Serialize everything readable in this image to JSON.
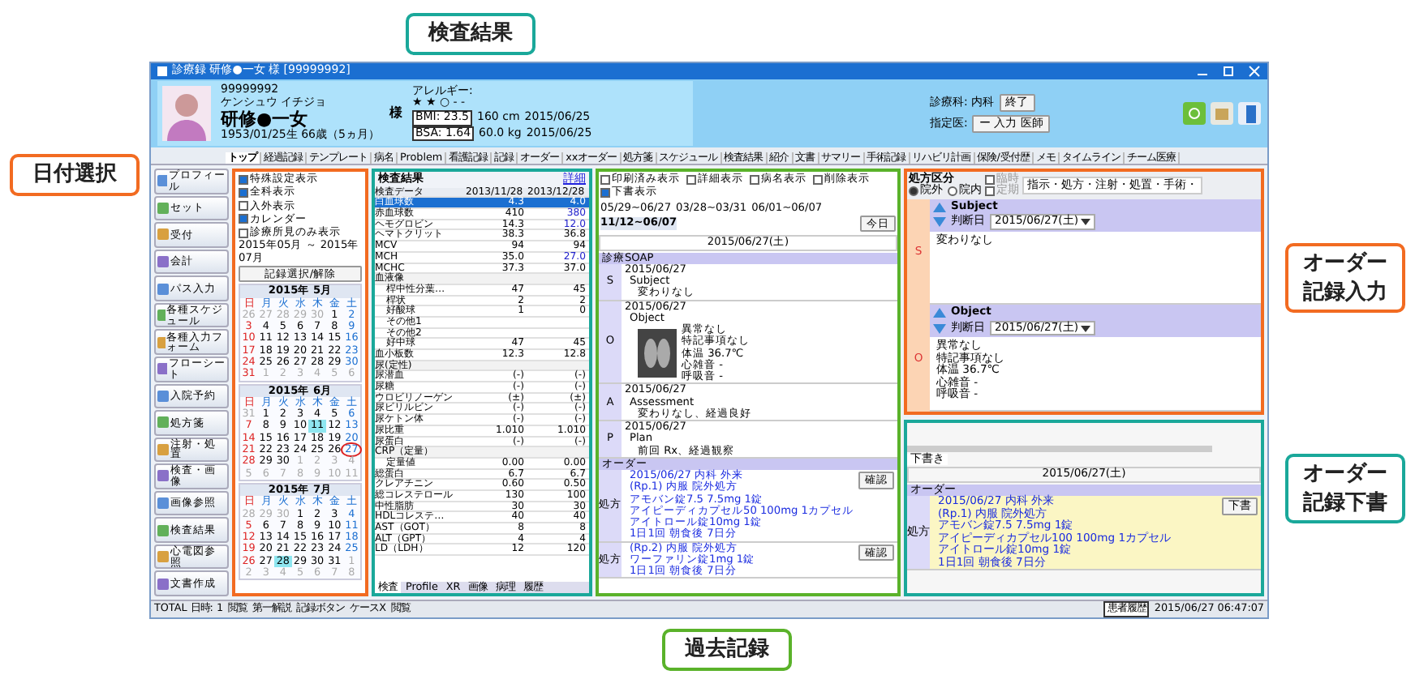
{
  "callouts": [
    {
      "text": "日付選択",
      "color": "#f26b21"
    },
    {
      "text": "検査結果",
      "color": "#1aa89a"
    },
    {
      "text": "オーダー記録入力",
      "color": "#f26b21"
    },
    {
      "text": "オーダー記録下書",
      "color": "#1aa89a"
    },
    {
      "text": "過去記録",
      "color": "#5ab22a"
    }
  ],
  "window": {
    "title": "診療録 研修●一女 様 [99999992]"
  },
  "patient": {
    "id": "99999992",
    "kana": "ケンシュウ イチジョ",
    "name": "研修●一女",
    "honorific": "様",
    "dob": "1953/01/25生 66歳（5ヵ月）",
    "allergy_label": "アレルギー:",
    "allergy_marks": "★ ★ ○ - -",
    "bmi": "BMI: 23.5",
    "bsa": "BSA: 1.64",
    "height": "160 cm",
    "weight": "60.0 kg",
    "height_date": "2015/06/25",
    "weight_date": "2015/06/25",
    "dept": "診療科: 内科",
    "dept_button": "終了",
    "doctor_label": "指定医:",
    "doctor": "ー 入力 医師"
  },
  "tabs": [
    {
      "label": "トップ",
      "selected": true
    },
    {
      "label": "経過記録",
      "selected": false
    },
    {
      "label": "テンプレート",
      "selected": false
    },
    {
      "label": "病名",
      "selected": false
    },
    {
      "label": "Problem",
      "selected": false
    },
    {
      "label": "看護記録",
      "selected": false
    },
    {
      "label": "記録",
      "selected": false
    },
    {
      "label": "オーダー",
      "selected": false
    },
    {
      "label": "xxオーダー",
      "selected": false
    },
    {
      "label": "処方箋",
      "selected": false
    },
    {
      "label": "スケジュール",
      "selected": false
    },
    {
      "label": "検査結果",
      "selected": false
    },
    {
      "label": "紹介",
      "selected": false
    },
    {
      "label": "文書",
      "selected": false
    },
    {
      "label": "サマリー",
      "selected": false
    },
    {
      "label": "手術記録",
      "selected": false
    },
    {
      "label": "リハビリ計画",
      "selected": false
    },
    {
      "label": "保険/受付歴",
      "selected": false
    },
    {
      "label": "メモ",
      "selected": false
    },
    {
      "label": "タイムライン",
      "selected": false
    },
    {
      "label": "チーム医療",
      "selected": false
    }
  ],
  "sidebar": [
    {
      "label": "プロフィール"
    },
    {
      "label": "セット"
    },
    {
      "label": "受付"
    },
    {
      "label": "会計"
    },
    {
      "label": "パス入力"
    },
    {
      "label": "各種スケジュール"
    },
    {
      "label": "各種入力フォーム"
    },
    {
      "label": "フローシート"
    },
    {
      "label": "入院予約"
    },
    {
      "label": "処方箋"
    },
    {
      "label": "注射・処置"
    },
    {
      "label": "検査・画像"
    },
    {
      "label": "画像参照"
    },
    {
      "label": "検査結果"
    },
    {
      "label": "心電図参照"
    },
    {
      "label": "文書作成"
    }
  ],
  "date_panel": {
    "options": [
      {
        "label": "特殊設定表示",
        "checked": true
      },
      {
        "label": "全科表示",
        "checked": true
      },
      {
        "label": "入外表示",
        "checked": false
      },
      {
        "label": "カレンダー",
        "checked": true
      },
      {
        "label": "診療所見のみ表示",
        "checked": false
      }
    ],
    "range": "2015年05月 ～ 2015年07月",
    "select_button": "記録選択/解除",
    "months": [
      {
        "title": "2015年 5月",
        "weekdays": [
          "日",
          "月",
          "火",
          "水",
          "木",
          "金",
          "土"
        ],
        "days": [
          {
            "day": "26",
            "kind": "out"
          },
          {
            "day": "27",
            "kind": "out"
          },
          {
            "day": "28",
            "kind": "out"
          },
          {
            "day": "29",
            "kind": "out"
          },
          {
            "day": "30",
            "kind": "out"
          },
          {
            "day": "1",
            "kind": "in"
          },
          {
            "day": "2",
            "kind": "in"
          },
          {
            "day": "3",
            "kind": "in"
          },
          {
            "day": "4",
            "kind": "in"
          },
          {
            "day": "5",
            "kind": "in"
          },
          {
            "day": "6",
            "kind": "in"
          },
          {
            "day": "7",
            "kind": "in"
          },
          {
            "day": "8",
            "kind": "in"
          },
          {
            "day": "9",
            "kind": "in"
          },
          {
            "day": "10",
            "kind": "in"
          },
          {
            "day": "11",
            "kind": "in"
          },
          {
            "day": "12",
            "kind": "in"
          },
          {
            "day": "13",
            "kind": "in"
          },
          {
            "day": "14",
            "kind": "in"
          },
          {
            "day": "15",
            "kind": "in"
          },
          {
            "day": "16",
            "kind": "in"
          },
          {
            "day": "17",
            "kind": "in"
          },
          {
            "day": "18",
            "kind": "in"
          },
          {
            "day": "19",
            "kind": "in"
          },
          {
            "day": "20",
            "kind": "in"
          },
          {
            "day": "21",
            "kind": "in"
          },
          {
            "day": "22",
            "kind": "in"
          },
          {
            "day": "23",
            "kind": "in"
          },
          {
            "day": "24",
            "kind": "in"
          },
          {
            "day": "25",
            "kind": "in"
          },
          {
            "day": "26",
            "kind": "in"
          },
          {
            "day": "27",
            "kind": "in"
          },
          {
            "day": "28",
            "kind": "in"
          },
          {
            "day": "29",
            "kind": "in"
          },
          {
            "day": "30",
            "kind": "in"
          },
          {
            "day": "31",
            "kind": "in"
          },
          {
            "day": "1",
            "kind": "out"
          },
          {
            "day": "2",
            "kind": "out"
          },
          {
            "day": "3",
            "kind": "out"
          },
          {
            "day": "4",
            "kind": "out"
          },
          {
            "day": "5",
            "kind": "out"
          },
          {
            "day": "6",
            "kind": "out"
          }
        ]
      },
      {
        "title": "2015年 6月",
        "weekdays": [
          "日",
          "月",
          "火",
          "水",
          "木",
          "金",
          "土"
        ],
        "days": [
          {
            "day": "31",
            "kind": "out"
          },
          {
            "day": "1",
            "kind": "in"
          },
          {
            "day": "2",
            "kind": "in"
          },
          {
            "day": "3",
            "kind": "in"
          },
          {
            "day": "4",
            "kind": "in"
          },
          {
            "day": "5",
            "kind": "in"
          },
          {
            "day": "6",
            "kind": "in"
          },
          {
            "day": "7",
            "kind": "in"
          },
          {
            "day": "8",
            "kind": "in"
          },
          {
            "day": "9",
            "kind": "in"
          },
          {
            "day": "10",
            "kind": "in"
          },
          {
            "day": "11",
            "kind": "mark"
          },
          {
            "day": "12",
            "kind": "in"
          },
          {
            "day": "13",
            "kind": "in"
          },
          {
            "day": "14",
            "kind": "in"
          },
          {
            "day": "15",
            "kind": "in"
          },
          {
            "day": "16",
            "kind": "in"
          },
          {
            "day": "17",
            "kind": "in"
          },
          {
            "day": "18",
            "kind": "in"
          },
          {
            "day": "19",
            "kind": "in"
          },
          {
            "day": "20",
            "kind": "in"
          },
          {
            "day": "21",
            "kind": "in"
          },
          {
            "day": "22",
            "kind": "in"
          },
          {
            "day": "23",
            "kind": "in"
          },
          {
            "day": "24",
            "kind": "in"
          },
          {
            "day": "25",
            "kind": "in"
          },
          {
            "day": "26",
            "kind": "in"
          },
          {
            "day": "27",
            "kind": "today"
          },
          {
            "day": "28",
            "kind": "in"
          },
          {
            "day": "29",
            "kind": "in"
          },
          {
            "day": "30",
            "kind": "in"
          },
          {
            "day": "1",
            "kind": "out"
          },
          {
            "day": "2",
            "kind": "out"
          },
          {
            "day": "3",
            "kind": "out"
          },
          {
            "day": "4",
            "kind": "out"
          },
          {
            "day": "5",
            "kind": "out"
          },
          {
            "day": "6",
            "kind": "out"
          },
          {
            "day": "7",
            "kind": "out"
          },
          {
            "day": "8",
            "kind": "out"
          },
          {
            "day": "9",
            "kind": "out"
          },
          {
            "day": "10",
            "kind": "out"
          },
          {
            "day": "11",
            "kind": "out"
          }
        ]
      },
      {
        "title": "2015年 7月",
        "weekdays": [
          "日",
          "月",
          "火",
          "水",
          "木",
          "金",
          "土"
        ],
        "days": [
          {
            "day": "28",
            "kind": "out"
          },
          {
            "day": "29",
            "kind": "out"
          },
          {
            "day": "30",
            "kind": "out"
          },
          {
            "day": "1",
            "kind": "in"
          },
          {
            "day": "2",
            "kind": "in"
          },
          {
            "day": "3",
            "kind": "in"
          },
          {
            "day": "4",
            "kind": "in"
          },
          {
            "day": "5",
            "kind": "in"
          },
          {
            "day": "6",
            "kind": "in"
          },
          {
            "day": "7",
            "kind": "in"
          },
          {
            "day": "8",
            "kind": "in"
          },
          {
            "day": "9",
            "kind": "in"
          },
          {
            "day": "10",
            "kind": "in"
          },
          {
            "day": "11",
            "kind": "in"
          },
          {
            "day": "12",
            "kind": "in"
          },
          {
            "day": "13",
            "kind": "in"
          },
          {
            "day": "14",
            "kind": "in"
          },
          {
            "day": "15",
            "kind": "in"
          },
          {
            "day": "16",
            "kind": "in"
          },
          {
            "day": "17",
            "kind": "in"
          },
          {
            "day": "18",
            "kind": "in"
          },
          {
            "day": "19",
            "kind": "in"
          },
          {
            "day": "20",
            "kind": "in"
          },
          {
            "day": "21",
            "kind": "in"
          },
          {
            "day": "22",
            "kind": "in"
          },
          {
            "day": "23",
            "kind": "in"
          },
          {
            "day": "24",
            "kind": "in"
          },
          {
            "day": "25",
            "kind": "in"
          },
          {
            "day": "26",
            "kind": "in"
          },
          {
            "day": "27",
            "kind": "in"
          },
          {
            "day": "28",
            "kind": "mark"
          },
          {
            "day": "29",
            "kind": "in"
          },
          {
            "day": "30",
            "kind": "in"
          },
          {
            "day": "31",
            "kind": "in"
          },
          {
            "day": "1",
            "kind": "out"
          },
          {
            "day": "2",
            "kind": "out"
          },
          {
            "day": "3",
            "kind": "out"
          },
          {
            "day": "4",
            "kind": "out"
          },
          {
            "day": "5",
            "kind": "out"
          },
          {
            "day": "6",
            "kind": "out"
          },
          {
            "day": "7",
            "kind": "out"
          },
          {
            "day": "8",
            "kind": "out"
          }
        ]
      }
    ]
  },
  "lab": {
    "title": "検査結果",
    "detail_link": "詳細",
    "columns": [
      "検査データ",
      "2013/11/28",
      "2013/12/28"
    ],
    "rows": [
      {
        "name": "白血球数",
        "kind": "data",
        "selected": true,
        "values": [
          {
            "text": "4.3",
            "low": false
          },
          {
            "text": "4.0",
            "low": false
          }
        ]
      },
      {
        "name": "赤血球数",
        "kind": "data",
        "selected": false,
        "values": [
          {
            "text": "410",
            "low": false
          },
          {
            "text": "380",
            "low": true
          }
        ]
      },
      {
        "name": "ヘモグロビン",
        "kind": "data",
        "selected": false,
        "values": [
          {
            "text": "14.3",
            "low": false
          },
          {
            "text": "12.0",
            "low": true
          }
        ]
      },
      {
        "name": "ヘマトクリット",
        "kind": "data",
        "selected": false,
        "values": [
          {
            "text": "38.3",
            "low": false
          },
          {
            "text": "36.8",
            "low": false
          }
        ]
      },
      {
        "name": "MCV",
        "kind": "data",
        "selected": false,
        "values": [
          {
            "text": "94",
            "low": false
          },
          {
            "text": "94",
            "low": false
          }
        ]
      },
      {
        "name": "MCH",
        "kind": "data",
        "selected": false,
        "values": [
          {
            "text": "35.0",
            "low": false
          },
          {
            "text": "27.0",
            "low": true
          }
        ]
      },
      {
        "name": "MCHC",
        "kind": "data",
        "selected": false,
        "values": [
          {
            "text": "37.3",
            "low": false
          },
          {
            "text": "37.0",
            "low": false
          }
        ]
      },
      {
        "name": "血液像",
        "kind": "section",
        "selected": false,
        "values": []
      },
      {
        "name": "桿中性分葉…",
        "kind": "sub",
        "selected": false,
        "values": [
          {
            "text": "47",
            "low": false
          },
          {
            "text": "45",
            "low": false
          }
        ]
      },
      {
        "name": "桿状",
        "kind": "sub",
        "selected": false,
        "values": [
          {
            "text": "2",
            "low": false
          },
          {
            "text": "2",
            "low": false
          }
        ]
      },
      {
        "name": "好酸球",
        "kind": "sub",
        "selected": false,
        "values": [
          {
            "text": "1",
            "low": false
          },
          {
            "text": "0",
            "low": false
          }
        ]
      },
      {
        "name": "その他1",
        "kind": "sub",
        "selected": false,
        "values": []
      },
      {
        "name": "その他2",
        "kind": "sub",
        "selected": false,
        "values": []
      },
      {
        "name": "好中球",
        "kind": "sub",
        "selected": false,
        "values": [
          {
            "text": "47",
            "low": false
          },
          {
            "text": "45",
            "low": false
          }
        ]
      },
      {
        "name": "血小板数",
        "kind": "data",
        "selected": false,
        "values": [
          {
            "text": "12.3",
            "low": false
          },
          {
            "text": "12.8",
            "low": false
          }
        ]
      },
      {
        "name": "尿(定性)",
        "kind": "section",
        "selected": false,
        "values": []
      },
      {
        "name": "尿潜血",
        "kind": "data",
        "selected": false,
        "values": [
          {
            "text": "(-)",
            "low": false
          },
          {
            "text": "(-)",
            "low": false
          }
        ]
      },
      {
        "name": "尿糖",
        "kind": "data",
        "selected": false,
        "values": [
          {
            "text": "(-)",
            "low": false
          },
          {
            "text": "(-)",
            "low": false
          }
        ]
      },
      {
        "name": "ウロビリノーゲン",
        "kind": "data",
        "selected": false,
        "values": [
          {
            "text": "(±)",
            "low": false
          },
          {
            "text": "(±)",
            "low": false
          }
        ]
      },
      {
        "name": "尿ビリルビン",
        "kind": "data",
        "selected": false,
        "values": [
          {
            "text": "(-)",
            "low": false
          },
          {
            "text": "(-)",
            "low": false
          }
        ]
      },
      {
        "name": "尿ケトン体",
        "kind": "data",
        "selected": false,
        "values": [
          {
            "text": "(-)",
            "low": false
          },
          {
            "text": "(-)",
            "low": false
          }
        ]
      },
      {
        "name": "尿比重",
        "kind": "data",
        "selected": false,
        "values": [
          {
            "text": "1.010",
            "low": false
          },
          {
            "text": "1.010",
            "low": false
          }
        ]
      },
      {
        "name": "尿蛋白",
        "kind": "data",
        "selected": false,
        "values": [
          {
            "text": "(-)",
            "low": false
          },
          {
            "text": "(-)",
            "low": false
          }
        ]
      },
      {
        "name": "CRP（定量）",
        "kind": "section",
        "selected": false,
        "values": []
      },
      {
        "name": "定量値",
        "kind": "sub",
        "selected": false,
        "values": [
          {
            "text": "0.00",
            "low": false
          },
          {
            "text": "0.00",
            "low": false
          }
        ]
      },
      {
        "name": "総蛋白",
        "kind": "data",
        "selected": false,
        "values": [
          {
            "text": "6.7",
            "low": false
          },
          {
            "text": "6.7",
            "low": false
          }
        ]
      },
      {
        "name": "クレアチニン",
        "kind": "data",
        "selected": false,
        "values": [
          {
            "text": "0.60",
            "low": false
          },
          {
            "text": "0.50",
            "low": false
          }
        ]
      },
      {
        "name": "総コレステロール",
        "kind": "data",
        "selected": false,
        "values": [
          {
            "text": "130",
            "low": false
          },
          {
            "text": "100",
            "low": false
          }
        ]
      },
      {
        "name": "中性脂肪",
        "kind": "data",
        "selected": false,
        "values": [
          {
            "text": "30",
            "low": false
          },
          {
            "text": "30",
            "low": false
          }
        ]
      },
      {
        "name": "HDLコレステ…",
        "kind": "data",
        "selected": false,
        "values": [
          {
            "text": "40",
            "low": false
          },
          {
            "text": "40",
            "low": false
          }
        ]
      },
      {
        "name": "AST（GOT）",
        "kind": "data",
        "selected": false,
        "values": [
          {
            "text": "8",
            "low": false
          },
          {
            "text": "8",
            "low": false
          }
        ]
      },
      {
        "name": "ALT（GPT）",
        "kind": "data",
        "selected": false,
        "values": [
          {
            "text": "4",
            "low": false
          },
          {
            "text": "4",
            "low": false
          }
        ]
      },
      {
        "name": "LD（LDH）",
        "kind": "data",
        "selected": false,
        "values": [
          {
            "text": "12",
            "low": false
          },
          {
            "text": "120",
            "low": false
          }
        ]
      }
    ],
    "bottom_tabs": [
      {
        "label": "検査",
        "selected": true
      },
      {
        "label": "Profile",
        "selected": false
      },
      {
        "label": "XR",
        "selected": false
      },
      {
        "label": "画像",
        "selected": false
      },
      {
        "label": "病理",
        "selected": false
      },
      {
        "label": "履歴",
        "selected": false
      }
    ]
  },
  "records": {
    "toggles": [
      {
        "label": "印刷済み表示",
        "checked": false
      },
      {
        "label": "詳細表示",
        "checked": false
      },
      {
        "label": "病名表示",
        "checked": false
      },
      {
        "label": "削除表示",
        "checked": false
      },
      {
        "label": "下書表示",
        "checked": true
      }
    ],
    "today_button": "今日",
    "ranges": [
      {
        "label": "05/29~06/27",
        "selected": false
      },
      {
        "label": "03/28~03/31",
        "selected": false
      },
      {
        "label": "06/01~06/07",
        "selected": false
      },
      {
        "label": "11/12~06/07",
        "selected": true
      }
    ],
    "date": "2015/06/27(土)",
    "soap_title": "診療SOAP",
    "soap": [
      {
        "letter": "S",
        "date": "2015/06/27",
        "heading": "Subject",
        "lines": [
          "変わりなし"
        ],
        "xray": false
      },
      {
        "letter": "O",
        "date": "2015/06/27",
        "heading": "Object",
        "lines": [
          "異常なし",
          "特記事項なし",
          "体温 36.7℃",
          "心雑音 -",
          "呼吸音 -"
        ],
        "xray": true
      },
      {
        "letter": "A",
        "date": "2015/06/27",
        "heading": "Assessment",
        "lines": [
          "変わりなし、経過良好"
        ],
        "xray": false
      },
      {
        "letter": "P",
        "date": "2015/06/27",
        "heading": "Plan",
        "lines": [
          "前回 Rx、経過観察"
        ],
        "xray": false
      }
    ],
    "order_title": "オーダー",
    "orders": [
      {
        "label": "処方",
        "button": "確認",
        "lines": [
          "2015/06/27 内科 外来",
          "(Rp.1) 内服  院外処方",
          "アモバン錠7.5 7.5mg 1錠",
          "アイピーディカプセル50 100mg 1カプセル",
          "アイトロール錠10mg 1錠",
          "1日1回 朝食後 7日分"
        ]
      },
      {
        "label": "処方",
        "button": "確認",
        "lines": [
          "(Rp.2) 内服  院外処方",
          "ワーファリン錠1mg 1錠",
          "1日1回 朝食後 7日分"
        ]
      }
    ]
  },
  "order_input": {
    "rx_label": "処方区分",
    "rx_options": [
      {
        "label": "院外",
        "selected": true
      },
      {
        "label": "院内",
        "selected": false
      }
    ],
    "temp_options": [
      {
        "label": "臨時",
        "checked": false
      },
      {
        "label": "定期",
        "checked": false
      }
    ],
    "order_types": "指示・処方・注射・処置・手術・",
    "sections": [
      {
        "letter": "S",
        "heading": "Subject",
        "date_label": "判断日",
        "date": "2015/06/27(土)",
        "lines": [
          "変わりなし"
        ]
      },
      {
        "letter": "O",
        "heading": "Object",
        "date_label": "判断日",
        "date": "2015/06/27(土)",
        "lines": [
          "異常なし",
          "特記事項なし",
          "体温 36.7℃",
          "心雑音 -",
          "呼吸音 -"
        ]
      }
    ]
  },
  "draft": {
    "tab": "下書き",
    "date": "2015/06/27(土)",
    "order_title": "オーダー",
    "label": "処方",
    "button": "下書",
    "lines": [
      "2015/06/27 内科 外来",
      "(Rp.1) 内服  院外処方",
      "アモバン錠7.5 7.5mg 1錠",
      "アイピーディカプセル100 100mg 1カプセル",
      "アイトロール錠10mg 1錠",
      "1日1回 朝食後 7日分"
    ]
  },
  "status_bar": {
    "items": [
      "TOTAL 日時: 1",
      "閲覧",
      "第一解説",
      "記録ボタン",
      "ケースX",
      "閲覧"
    ],
    "right_label": "患者履歴",
    "timestamp": "2015/06/27 06:47:07"
  }
}
